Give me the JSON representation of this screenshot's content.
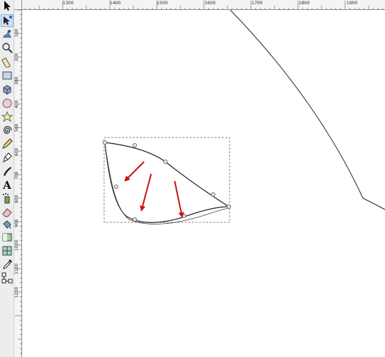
{
  "toolbox": {
    "tools": [
      {
        "name": "selector-icon",
        "active": false
      },
      {
        "name": "node-editor-icon",
        "active": true
      },
      {
        "name": "tweak-icon",
        "active": false
      },
      {
        "name": "zoom-icon",
        "active": false
      },
      {
        "name": "measure-icon",
        "active": false
      },
      {
        "name": "rectangle-icon",
        "active": false
      },
      {
        "name": "box3d-icon",
        "active": false
      },
      {
        "name": "ellipse-icon",
        "active": false
      },
      {
        "name": "star-icon",
        "active": false
      },
      {
        "name": "spiral-icon",
        "active": false
      },
      {
        "name": "pencil-icon",
        "active": false
      },
      {
        "name": "pen-icon",
        "active": false
      },
      {
        "name": "calligraphy-icon",
        "active": false
      },
      {
        "name": "text-icon",
        "active": false
      },
      {
        "name": "spray-icon",
        "active": false
      },
      {
        "name": "eraser-icon",
        "active": false
      },
      {
        "name": "paint-bucket-icon",
        "active": false
      },
      {
        "name": "gradient-icon",
        "active": false
      },
      {
        "name": "mesh-icon",
        "active": false
      },
      {
        "name": "dropper-icon",
        "active": false
      },
      {
        "name": "connector-icon",
        "active": false
      }
    ],
    "text_tool_glyph": "A"
  },
  "rulers": {
    "horizontal_labels": [
      "1300",
      "1400",
      "1500",
      "1600",
      "1700",
      "1800",
      "1900"
    ],
    "vertical_labels": [
      "100",
      "200",
      "300",
      "400",
      "500",
      "600",
      "700",
      "800",
      "900",
      "1000",
      "1100",
      "1200"
    ]
  },
  "colors": {
    "arrow": "#cc1111",
    "path": "#222222",
    "selection": "#888888",
    "ui_bg": "#ededed"
  }
}
